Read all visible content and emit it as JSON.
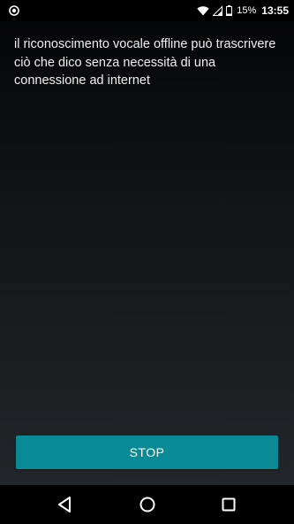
{
  "status_bar": {
    "battery_percent": "15%",
    "time": "13:55",
    "left_icon": "record-dot-icon",
    "icons": [
      "wifi-icon",
      "signal-icon",
      "battery-icon"
    ]
  },
  "main": {
    "transcript_text": "il riconoscimento vocale offline può trascrivere ciò che dico senza necessità di una connessione ad internet",
    "stop_button_label": "STOP"
  },
  "colors": {
    "accent": "#0a8a96",
    "text": "#f0f0f0",
    "background_top": "#050607",
    "background_bottom": "#23262a"
  },
  "nav_bar": {
    "icons": [
      "back-icon",
      "home-icon",
      "recents-icon"
    ]
  }
}
